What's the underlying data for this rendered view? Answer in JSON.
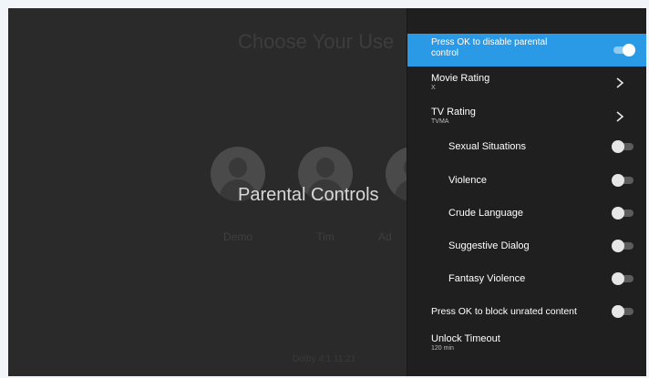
{
  "background": {
    "title": "Choose Your Use",
    "users": [
      "Demo",
      "Tim",
      "Ad"
    ],
    "overlay_label": "Parental Controls",
    "bottom_text": "Dolby 4:1 11:21"
  },
  "panel": {
    "disable_parental": {
      "label1": "Press OK to disable parental",
      "label2": "control",
      "toggle_on": true
    },
    "movie_rating": {
      "label": "Movie Rating",
      "value": "X"
    },
    "tv_rating": {
      "label": "TV Rating",
      "value": "TVMA"
    },
    "items": [
      {
        "label": "Sexual Situations",
        "toggle_on": false
      },
      {
        "label": "Violence",
        "toggle_on": false
      },
      {
        "label": "Crude Language",
        "toggle_on": false
      },
      {
        "label": "Suggestive Dialog",
        "toggle_on": false
      },
      {
        "label": "Fantasy Violence",
        "toggle_on": false
      }
    ],
    "block_unrated": {
      "label": "Press OK to block unrated content",
      "toggle_on": false
    },
    "unlock_timeout": {
      "label": "Unlock Timeout",
      "value": "120 min"
    }
  },
  "colors": {
    "selected_row": "#2b9ae6",
    "panel_bg": "#1f1f1f",
    "screen_bg": "#2a2a2a"
  },
  "icons": [
    "user-avatar-icon",
    "toggle-switch-icon",
    "chevron-right-icon"
  ]
}
